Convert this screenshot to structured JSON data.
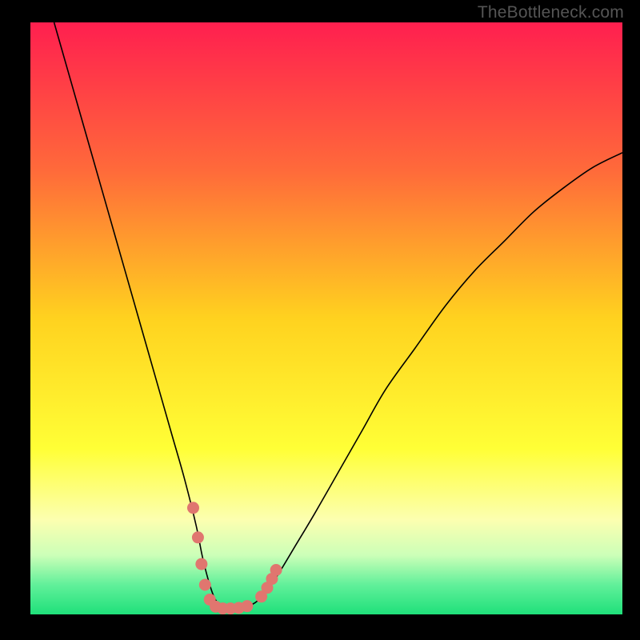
{
  "attribution": "TheBottleneck.com",
  "chart_data": {
    "type": "line",
    "title": "",
    "xlabel": "",
    "ylabel": "",
    "xlim": [
      0,
      100
    ],
    "ylim": [
      0,
      100
    ],
    "background_gradient": {
      "stops": [
        {
          "offset": 0,
          "color": "#ff1f4f"
        },
        {
          "offset": 25,
          "color": "#ff6a3a"
        },
        {
          "offset": 50,
          "color": "#ffd21f"
        },
        {
          "offset": 72,
          "color": "#ffff36"
        },
        {
          "offset": 84,
          "color": "#fcffb0"
        },
        {
          "offset": 90,
          "color": "#ccffb8"
        },
        {
          "offset": 95,
          "color": "#61f09a"
        },
        {
          "offset": 100,
          "color": "#1fe07a"
        }
      ]
    },
    "series": [
      {
        "name": "bottleneck-curve",
        "stroke": "#000000",
        "stroke_width": 1.6,
        "x": [
          4,
          6,
          8,
          10,
          12,
          14,
          16,
          18,
          20,
          22,
          24,
          26,
          28,
          29,
          30,
          31,
          32,
          33,
          34,
          36,
          38,
          40,
          42,
          45,
          48,
          52,
          56,
          60,
          65,
          70,
          75,
          80,
          85,
          90,
          95,
          100
        ],
        "y": [
          100,
          93,
          86,
          79,
          72,
          65,
          58,
          51,
          44,
          37,
          30,
          23,
          15,
          10,
          6,
          3,
          1.5,
          1,
          1,
          1.2,
          2,
          4,
          7,
          12,
          17,
          24,
          31,
          38,
          45,
          52,
          58,
          63,
          68,
          72,
          75.5,
          78
        ]
      }
    ],
    "markers": {
      "name": "highlight-dots",
      "fill": "#e0766f",
      "radius": 7.5,
      "points": [
        {
          "x": 27.5,
          "y": 18
        },
        {
          "x": 28.3,
          "y": 13
        },
        {
          "x": 28.9,
          "y": 8.5
        },
        {
          "x": 29.5,
          "y": 5
        },
        {
          "x": 30.3,
          "y": 2.5
        },
        {
          "x": 31.3,
          "y": 1.3
        },
        {
          "x": 32.5,
          "y": 1
        },
        {
          "x": 33.8,
          "y": 1
        },
        {
          "x": 35.2,
          "y": 1.1
        },
        {
          "x": 36.6,
          "y": 1.4
        },
        {
          "x": 39.0,
          "y": 3.0
        },
        {
          "x": 40.0,
          "y": 4.5
        },
        {
          "x": 40.8,
          "y": 6.0
        },
        {
          "x": 41.5,
          "y": 7.5
        }
      ]
    }
  }
}
